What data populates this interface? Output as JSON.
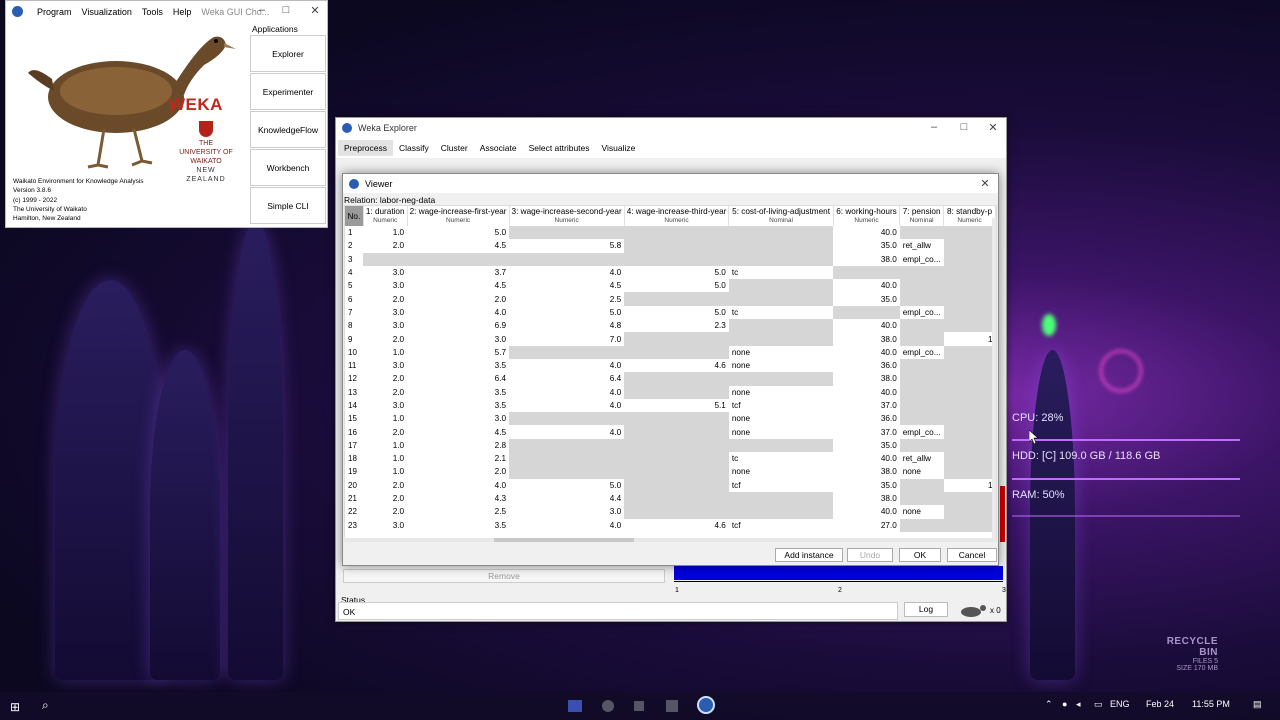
{
  "chooser": {
    "menu": [
      "Program",
      "Visualization",
      "Tools",
      "Help"
    ],
    "title": "Weka GUI Cho...",
    "logo_text": "WEKA",
    "university": "THE UNIVERSITY OF WAIKATO",
    "country": "NEW ZEALAND",
    "info": [
      "Waikato Environment for Knowledge Analysis",
      "Version 3.8.6",
      "(c) 1999 - 2022",
      "The University of Waikato",
      "Hamilton, New Zealand"
    ],
    "apps_label": "Applications",
    "apps": [
      "Explorer",
      "Experimenter",
      "KnowledgeFlow",
      "Workbench",
      "Simple CLI"
    ]
  },
  "explorer": {
    "title": "Weka Explorer",
    "tabs": [
      "Preprocess",
      "Classify",
      "Cluster",
      "Associate",
      "Select attributes",
      "Visualize"
    ],
    "remove_label": "Remove",
    "status_label": "Status",
    "status_value": "OK",
    "log_label": "Log",
    "x_count": "x 0",
    "axis_ticks": [
      "1",
      "2",
      "3"
    ]
  },
  "viewer": {
    "title": "Viewer",
    "relation": "Relation: labor-neg-data",
    "columns": [
      {
        "name": "No.",
        "type": ""
      },
      {
        "name": "1: duration",
        "type": "Numeric"
      },
      {
        "name": "2: wage-increase-first-year",
        "type": "Numeric"
      },
      {
        "name": "3: wage-increase-second-year",
        "type": "Numeric"
      },
      {
        "name": "4: wage-increase-third-year",
        "type": "Numeric"
      },
      {
        "name": "5: cost-of-living-adjustment",
        "type": "Nominal"
      },
      {
        "name": "6: working-hours",
        "type": "Numeric"
      },
      {
        "name": "7: pension",
        "type": "Nominal"
      },
      {
        "name": "8: standby-p",
        "type": "Numeric"
      }
    ],
    "rows": [
      [
        "1",
        "1.0",
        "5.0",
        "",
        "",
        "",
        "40.0",
        "",
        ""
      ],
      [
        "2",
        "2.0",
        "4.5",
        "5.8",
        "",
        "",
        "35.0",
        "ret_allw",
        ""
      ],
      [
        "3",
        "",
        "",
        "",
        "",
        "",
        "38.0",
        "empl_co...",
        ""
      ],
      [
        "4",
        "3.0",
        "3.7",
        "4.0",
        "5.0",
        "tc",
        "",
        "",
        ""
      ],
      [
        "5",
        "3.0",
        "4.5",
        "4.5",
        "5.0",
        "",
        "40.0",
        "",
        ""
      ],
      [
        "6",
        "2.0",
        "2.0",
        "2.5",
        "",
        "",
        "35.0",
        "",
        ""
      ],
      [
        "7",
        "3.0",
        "4.0",
        "5.0",
        "5.0",
        "tc",
        "",
        "empl_co...",
        ""
      ],
      [
        "8",
        "3.0",
        "6.9",
        "4.8",
        "2.3",
        "",
        "40.0",
        "",
        ""
      ],
      [
        "9",
        "2.0",
        "3.0",
        "7.0",
        "",
        "",
        "38.0",
        "",
        "1"
      ],
      [
        "10",
        "1.0",
        "5.7",
        "",
        "",
        "none",
        "40.0",
        "empl_co...",
        ""
      ],
      [
        "11",
        "3.0",
        "3.5",
        "4.0",
        "4.6",
        "none",
        "36.0",
        "",
        ""
      ],
      [
        "12",
        "2.0",
        "6.4",
        "6.4",
        "",
        "",
        "38.0",
        "",
        ""
      ],
      [
        "13",
        "2.0",
        "3.5",
        "4.0",
        "",
        "none",
        "40.0",
        "",
        ""
      ],
      [
        "14",
        "3.0",
        "3.5",
        "4.0",
        "5.1",
        "tcf",
        "37.0",
        "",
        ""
      ],
      [
        "15",
        "1.0",
        "3.0",
        "",
        "",
        "none",
        "36.0",
        "",
        ""
      ],
      [
        "16",
        "2.0",
        "4.5",
        "4.0",
        "",
        "none",
        "37.0",
        "empl_co...",
        ""
      ],
      [
        "17",
        "1.0",
        "2.8",
        "",
        "",
        "",
        "35.0",
        "",
        ""
      ],
      [
        "18",
        "1.0",
        "2.1",
        "",
        "",
        "tc",
        "40.0",
        "ret_allw",
        ""
      ],
      [
        "19",
        "1.0",
        "2.0",
        "",
        "",
        "none",
        "38.0",
        "none",
        ""
      ],
      [
        "20",
        "2.0",
        "4.0",
        "5.0",
        "",
        "tcf",
        "35.0",
        "",
        "1"
      ],
      [
        "21",
        "2.0",
        "4.3",
        "4.4",
        "",
        "",
        "38.0",
        "",
        ""
      ],
      [
        "22",
        "2.0",
        "2.5",
        "3.0",
        "",
        "",
        "40.0",
        "none",
        ""
      ],
      [
        "23",
        "3.0",
        "3.5",
        "4.0",
        "4.6",
        "tcf",
        "27.0",
        "",
        ""
      ]
    ],
    "buttons": {
      "add": "Add instance",
      "undo": "Undo",
      "ok": "OK",
      "cancel": "Cancel"
    }
  },
  "desktop": {
    "cpu": "CPU: 28%",
    "hdd": "HDD: [C] 109.0 GB / 118.6 GB",
    "ram": "RAM: 50%",
    "recycle_title": "RECYCLE BIN",
    "recycle_files": "FILES 5",
    "recycle_size": "SIZE 170 MB"
  },
  "taskbar": {
    "lang": "ENG",
    "date": "Feb 24",
    "time": "11:55 PM"
  },
  "colors": {
    "accent_blue": "#0000dd",
    "bar_red": "#cc0000",
    "desktop_purple": "#3b1466"
  }
}
